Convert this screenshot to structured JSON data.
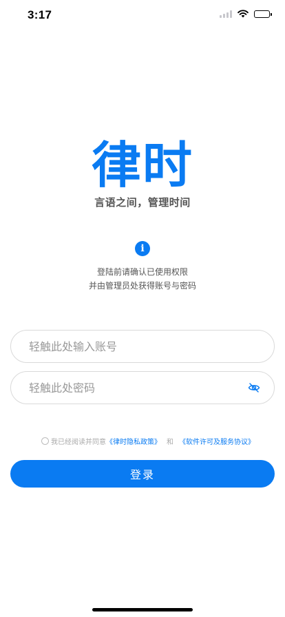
{
  "status_bar": {
    "time": "3:17"
  },
  "brand": {
    "logo_text": "律时",
    "slogan": "言语之间，管理时间",
    "accent_color": "#0a7bf2"
  },
  "info": {
    "icon_glyph": "i",
    "line1": "登陆前请确认已使用权限",
    "line2": "并由管理员处获得账号与密码"
  },
  "form": {
    "account_placeholder": "轻触此处输入账号",
    "account_value": "",
    "password_placeholder": "轻触此处密码",
    "password_value": "",
    "password_toggle_icon": "eye-off-icon"
  },
  "agreement": {
    "checked": false,
    "prefix": "我已经阅读并同意",
    "privacy_link": "《律时隐私政策》",
    "conjunction": "和",
    "license_link": "《软件许可及服务协议》"
  },
  "login_button": {
    "label": "登录"
  }
}
